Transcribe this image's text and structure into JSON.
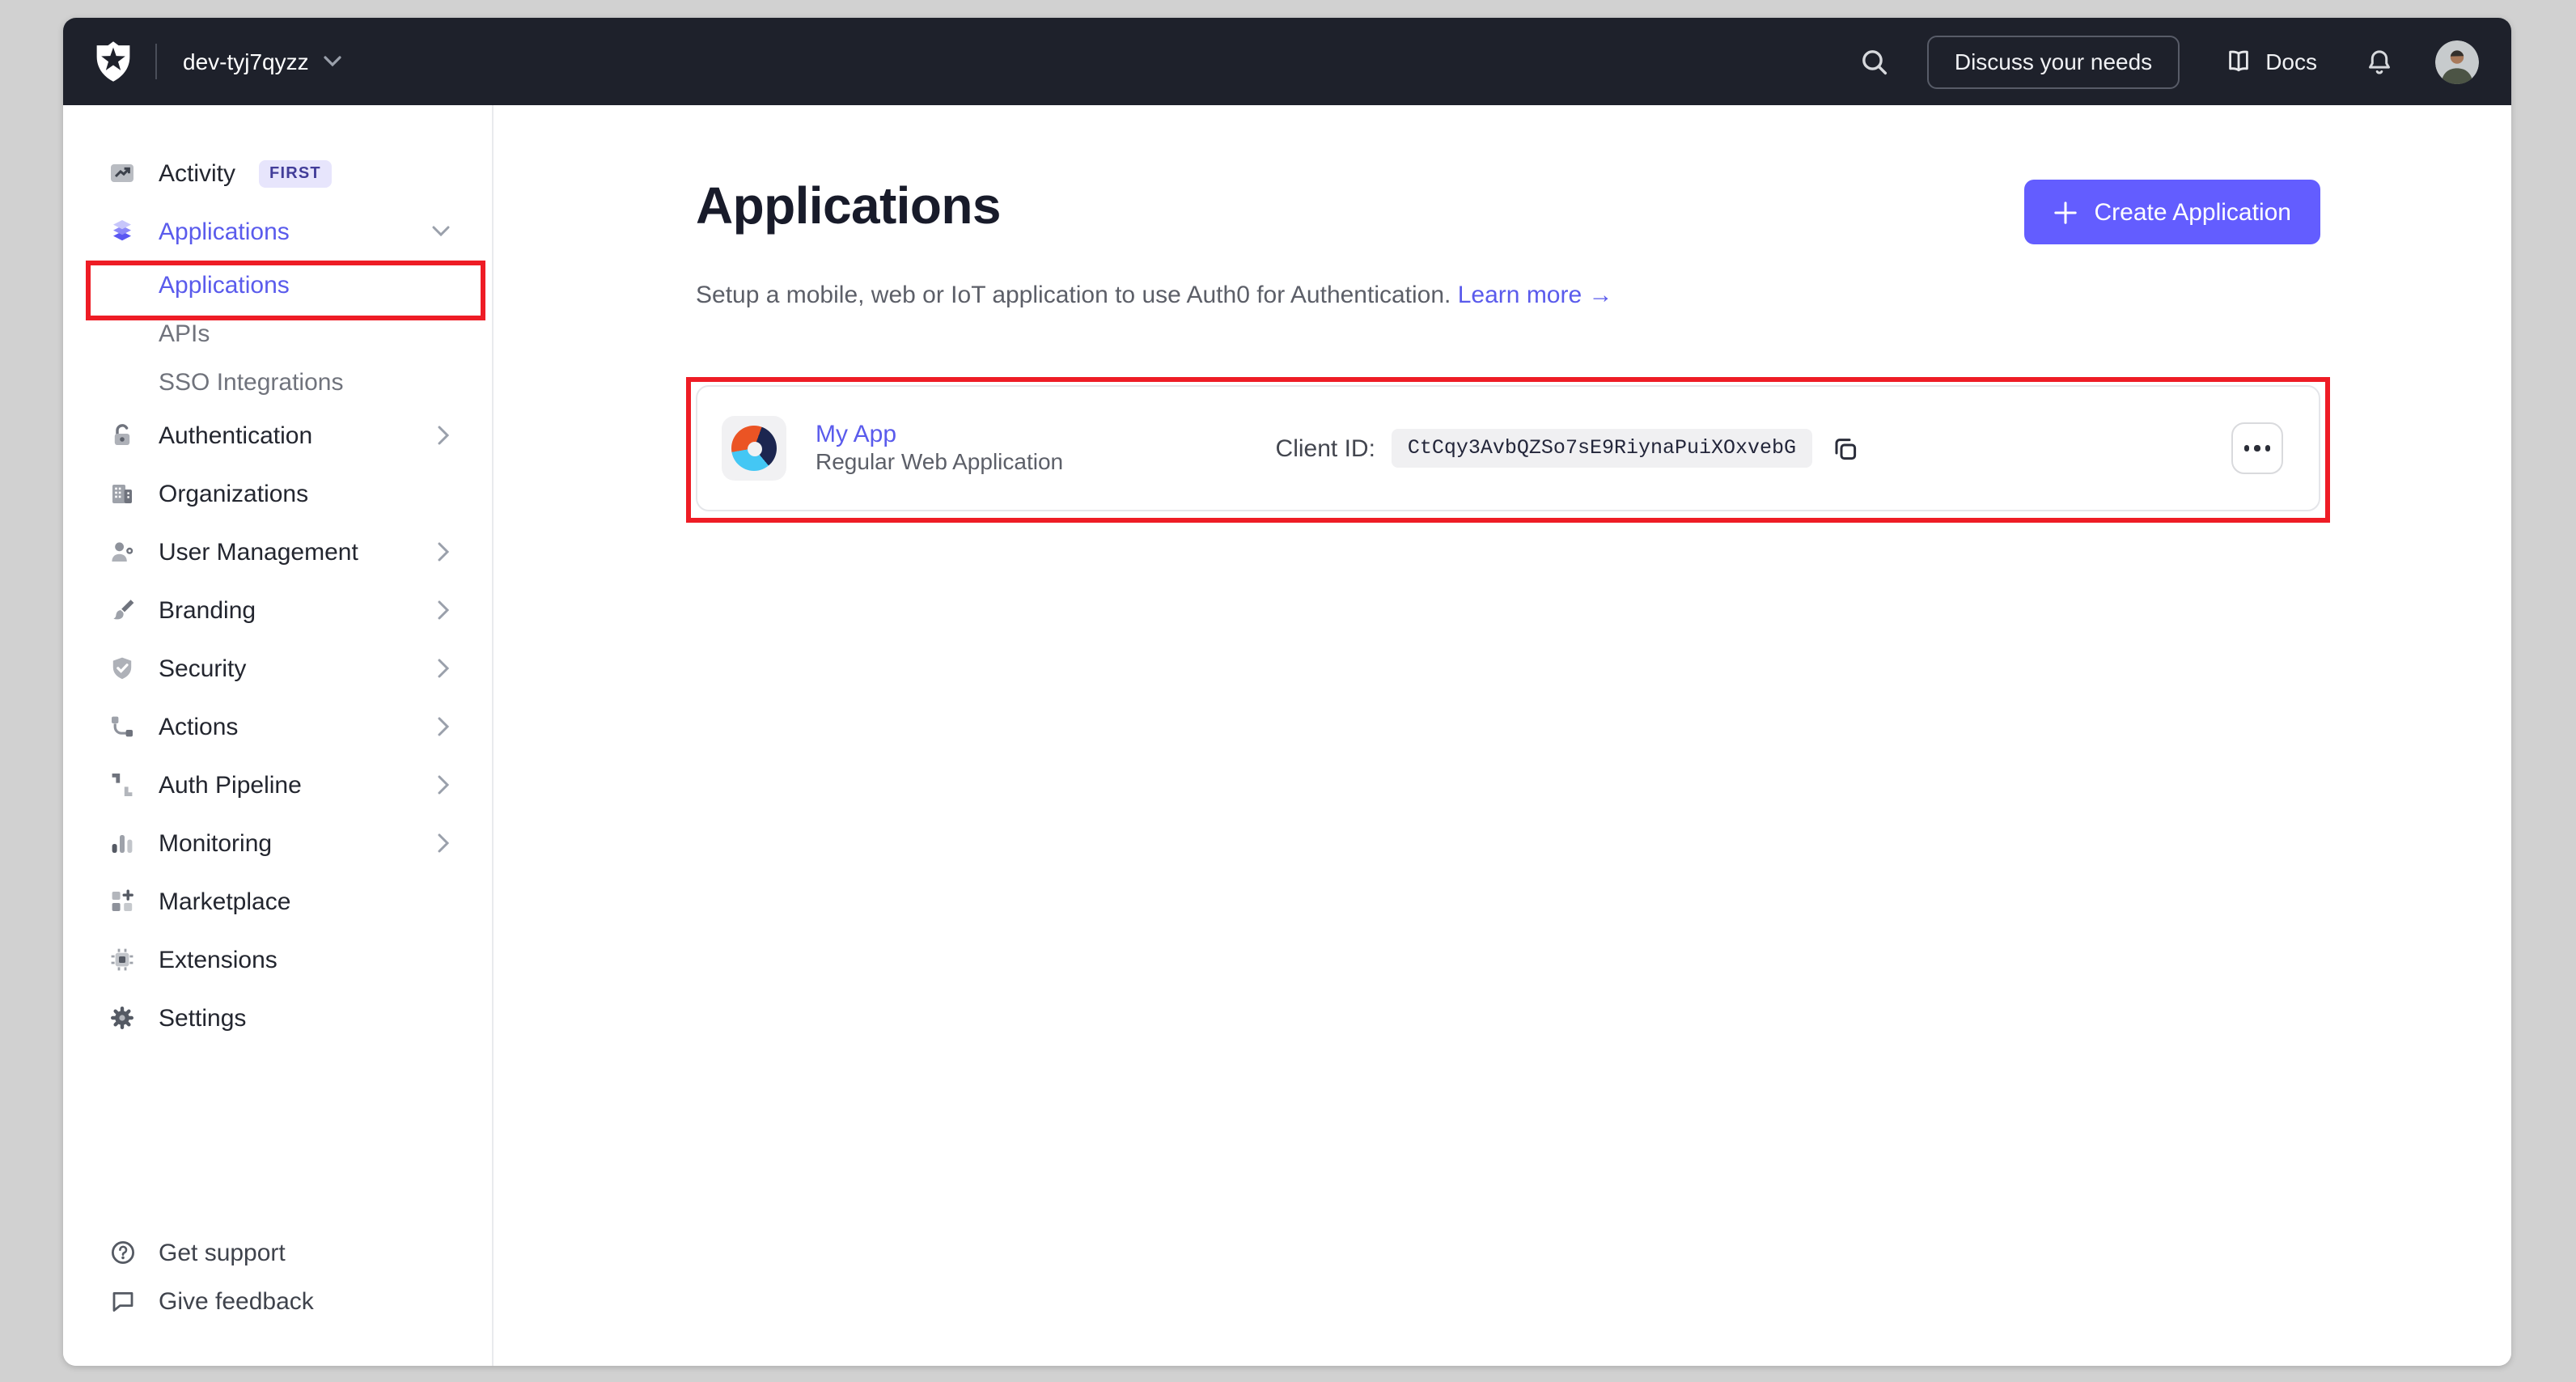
{
  "topbar": {
    "tenant": "dev-tyj7qyzz",
    "discuss_button": "Discuss your needs",
    "docs_label": "Docs"
  },
  "sidebar": {
    "items": [
      {
        "label": "Activity",
        "badge": "FIRST",
        "icon": "activity"
      },
      {
        "label": "Applications",
        "icon": "applications",
        "expanded": true,
        "active": true,
        "children": [
          {
            "label": "Applications",
            "active": true,
            "annotated": true
          },
          {
            "label": "APIs"
          },
          {
            "label": "SSO Integrations"
          }
        ]
      },
      {
        "label": "Authentication",
        "icon": "lock",
        "chevron": "right"
      },
      {
        "label": "Organizations",
        "icon": "building"
      },
      {
        "label": "User Management",
        "icon": "user-gear",
        "chevron": "right"
      },
      {
        "label": "Branding",
        "icon": "paintbrush",
        "chevron": "right"
      },
      {
        "label": "Security",
        "icon": "shield-check",
        "chevron": "right"
      },
      {
        "label": "Actions",
        "icon": "flow",
        "chevron": "right"
      },
      {
        "label": "Auth Pipeline",
        "icon": "pipeline",
        "chevron": "right"
      },
      {
        "label": "Monitoring",
        "icon": "bar-chart",
        "chevron": "right"
      },
      {
        "label": "Marketplace",
        "icon": "grid-plus"
      },
      {
        "label": "Extensions",
        "icon": "chip"
      },
      {
        "label": "Settings",
        "icon": "gear"
      }
    ],
    "footer": [
      {
        "label": "Get support",
        "icon": "help-circle"
      },
      {
        "label": "Give feedback",
        "icon": "speech-bubble"
      }
    ]
  },
  "main": {
    "title": "Applications",
    "subtitle": "Setup a mobile, web or IoT application to use Auth0 for Authentication.",
    "learn_more": "Learn more",
    "learn_more_arrow": "→",
    "create_button": "Create Application",
    "app": {
      "name": "My App",
      "type": "Regular Web Application",
      "client_id_label": "Client ID:",
      "client_id": "CtCqy3AvbQZSo7sE9RiynaPuiXOxvebG"
    }
  },
  "colors": {
    "accent": "#635dff",
    "annotation_red": "#ee1c25",
    "topbar_bg": "#1e212b",
    "badge_bg": "#e7e5fc",
    "badge_text": "#423d99",
    "app_logo_orange": "#eb5424",
    "app_logo_navy": "#1c2650",
    "app_logo_blue": "#44c7f4"
  }
}
